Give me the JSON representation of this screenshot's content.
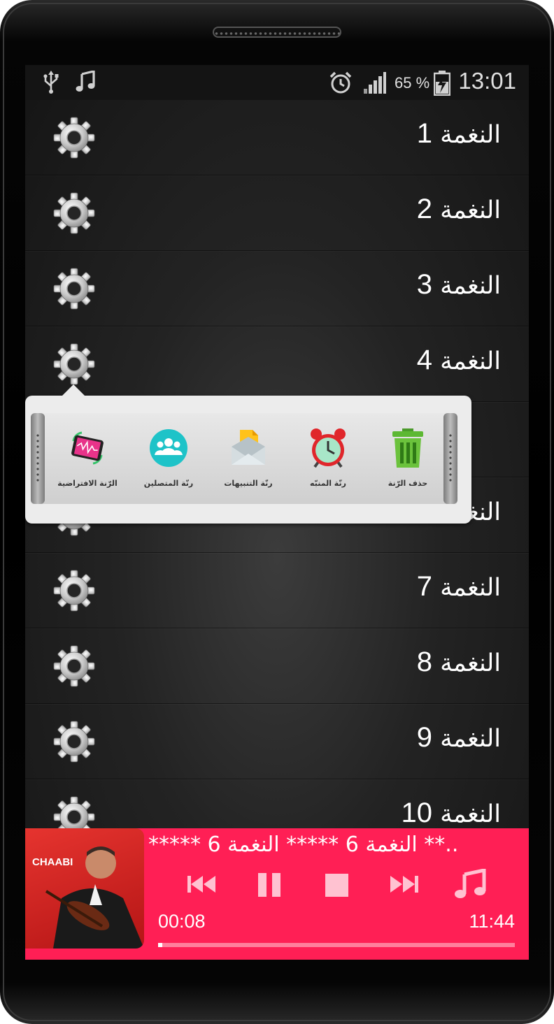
{
  "status_bar": {
    "battery_percent": "65 %",
    "time": "13:01",
    "icons": [
      "usb-icon",
      "music-note-icon",
      "alarm-icon",
      "signal-icon",
      "battery-charging-icon"
    ]
  },
  "ringtones": [
    {
      "label": "النغمة",
      "num": "1"
    },
    {
      "label": "النغمة",
      "num": "2"
    },
    {
      "label": "النغمة",
      "num": "3"
    },
    {
      "label": "النغمة",
      "num": "4"
    },
    {
      "label": "",
      "num": ""
    },
    {
      "label": "النغمة",
      "num": ""
    },
    {
      "label": "النغمة",
      "num": "7"
    },
    {
      "label": "النغمة",
      "num": "8"
    },
    {
      "label": "النغمة",
      "num": "9"
    },
    {
      "label": "النغمة",
      "num": "10"
    }
  ],
  "popup_menu": {
    "options": [
      {
        "label": "حذف الرّنة",
        "icon": "trash-icon"
      },
      {
        "label": "رنّة المنبّه",
        "icon": "alarm-clock-icon"
      },
      {
        "label": "رنّة التنبيهات",
        "icon": "envelope-icon"
      },
      {
        "label": "رنّة المتصلين",
        "icon": "contacts-icon"
      },
      {
        "label": "الرّنة الافتراضية",
        "icon": "phone-ringtone-icon"
      }
    ]
  },
  "player": {
    "album_label": "CHAABI",
    "ticker_text": "*****  النغمة 6  *****  النغمة 6  **..",
    "current_time": "00:08",
    "total_time": "11:44",
    "progress": 0.011,
    "accent_color": "#ff1f55"
  }
}
